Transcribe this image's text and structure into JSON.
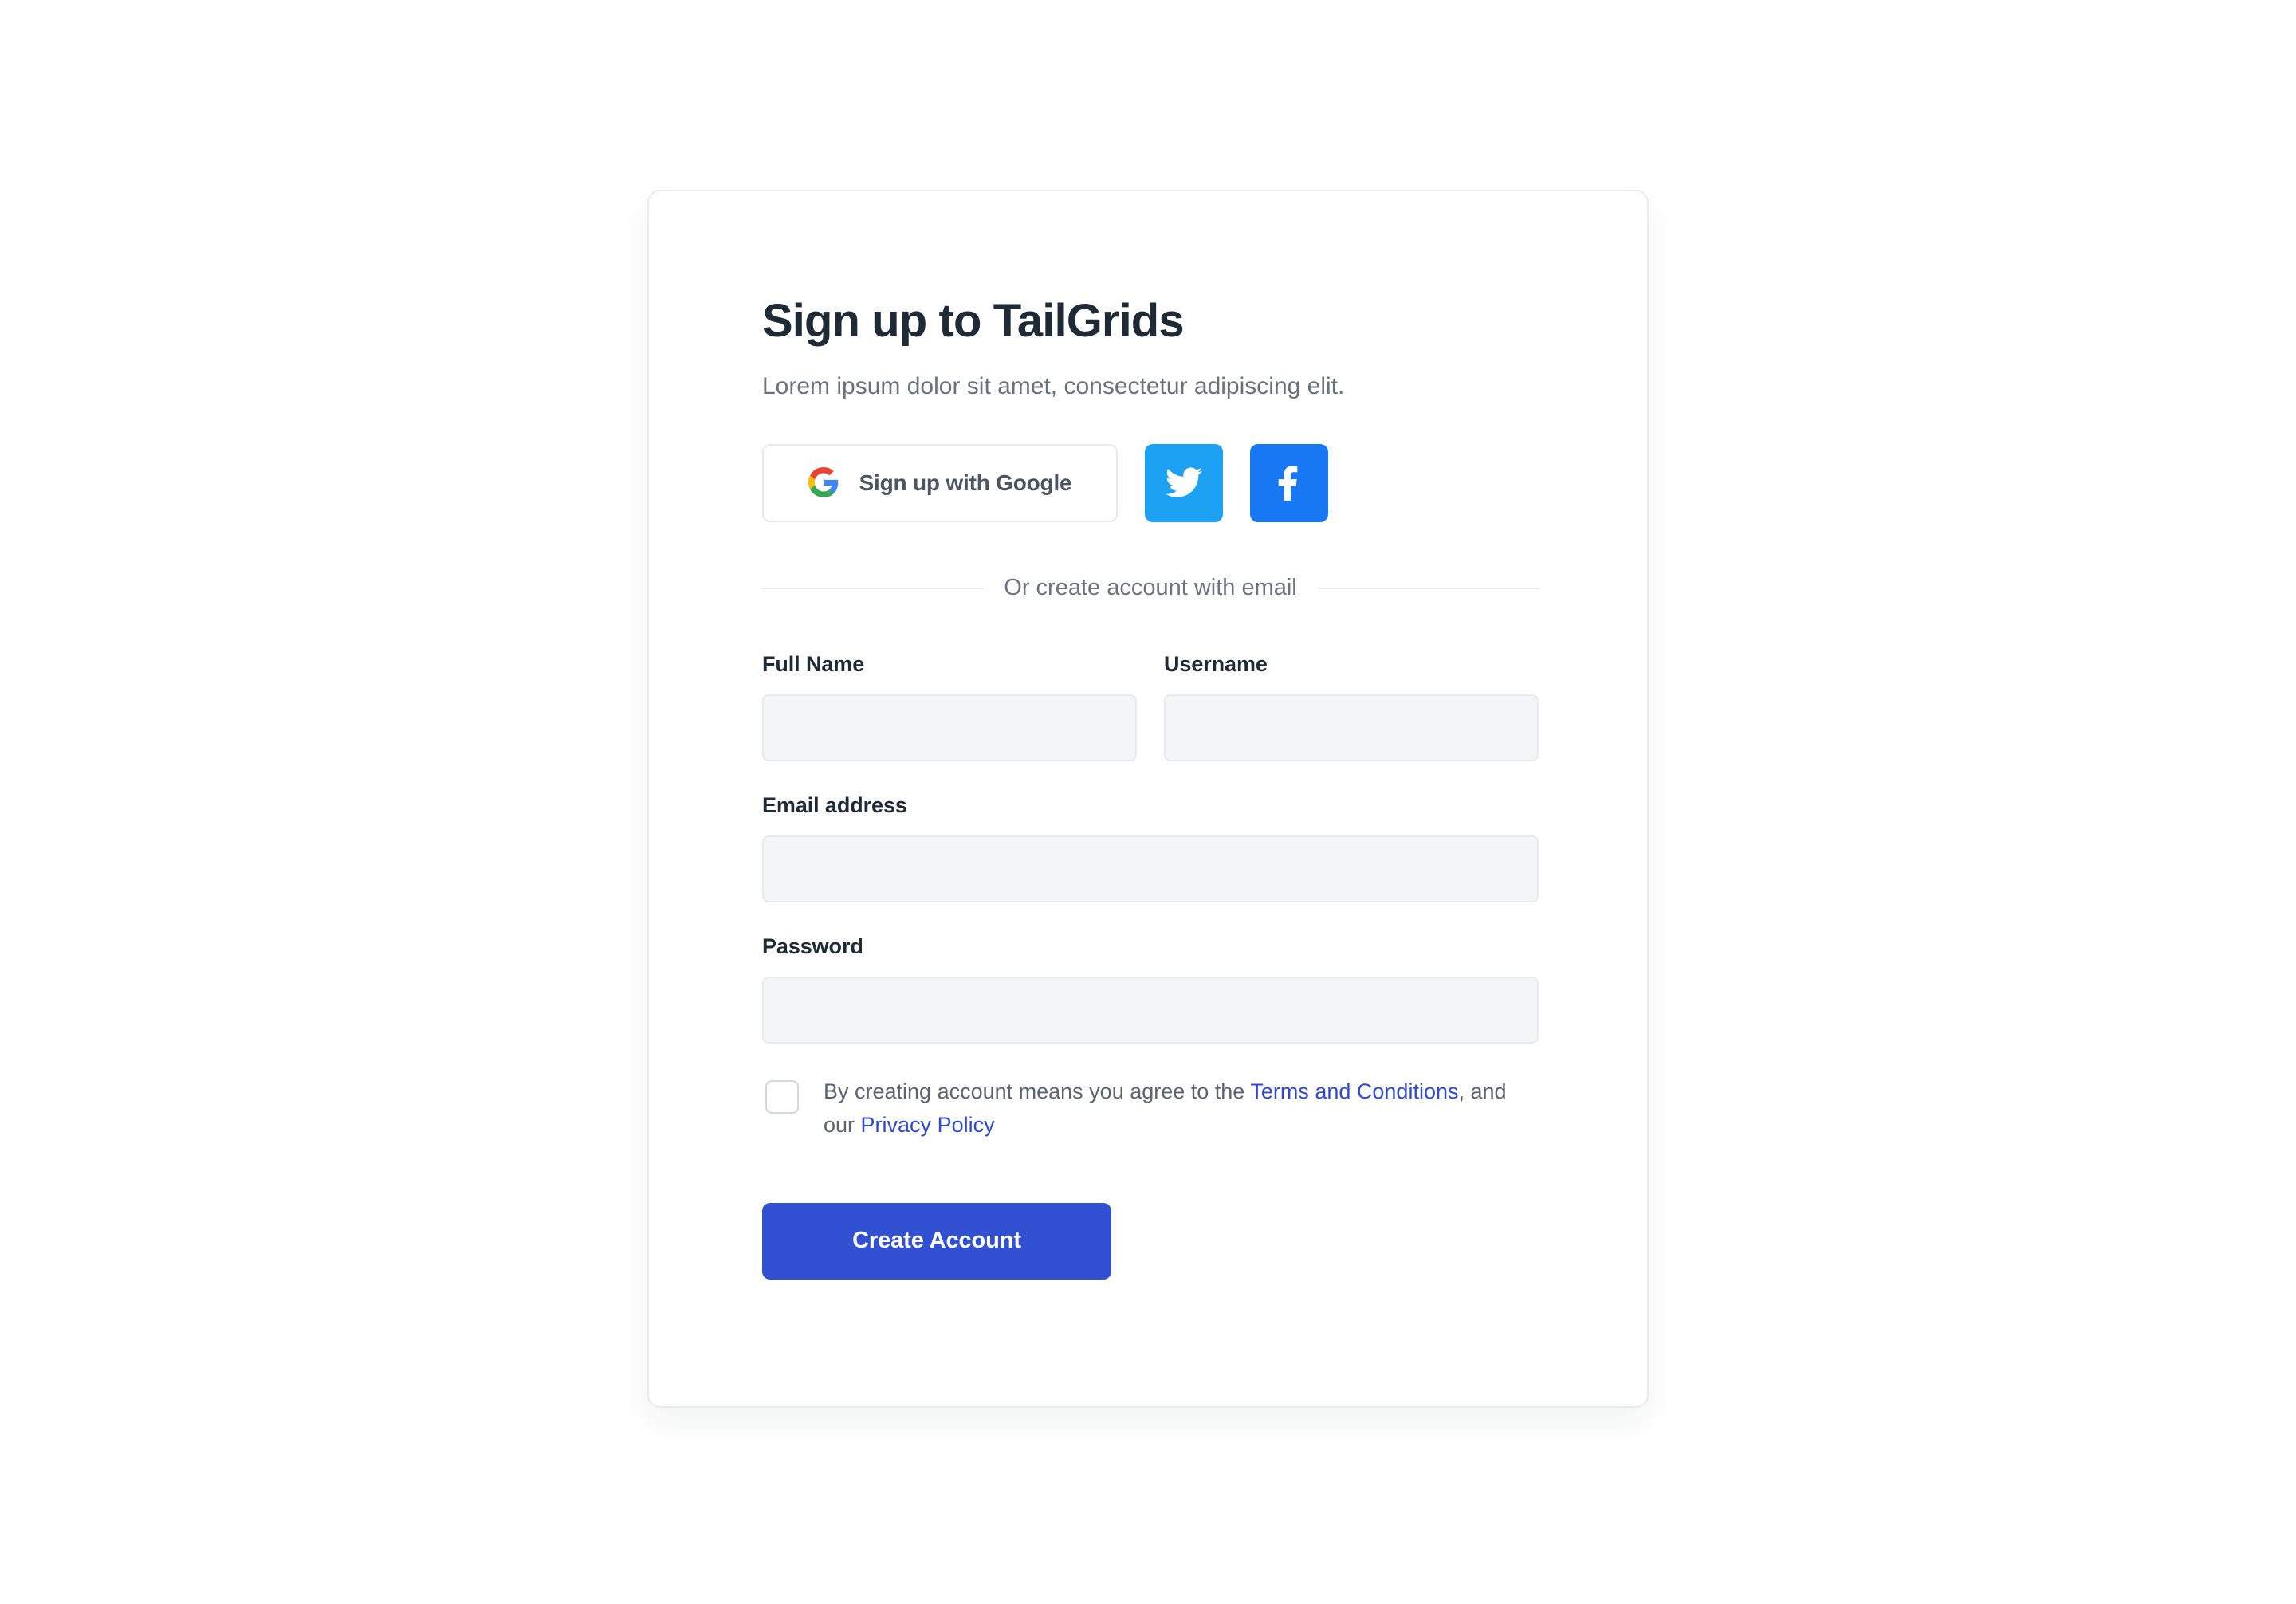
{
  "card": {
    "title": "Sign up to TailGrids",
    "subtitle": "Lorem ipsum dolor sit amet, consectetur adipiscing elit."
  },
  "social": {
    "google_label": "Sign up with Google",
    "google_icon": "google-icon",
    "twitter_icon": "twitter-icon",
    "facebook_icon": "facebook-icon",
    "twitter_color": "#1DA1F2",
    "facebook_color": "#1877F2"
  },
  "divider": {
    "text": "Or create account with email"
  },
  "form": {
    "full_name": {
      "label": "Full Name",
      "value": "",
      "placeholder": ""
    },
    "username": {
      "label": "Username",
      "value": "",
      "placeholder": ""
    },
    "email": {
      "label": "Email address",
      "value": "",
      "placeholder": ""
    },
    "password": {
      "label": "Password",
      "value": "",
      "placeholder": ""
    }
  },
  "terms": {
    "checked": false,
    "text_before": "By creating account means you agree to the",
    "terms_link": "Terms and Conditions",
    "text_middle": ", and our",
    "privacy_link": "Privacy Policy",
    "link_color": "#2F49D1"
  },
  "submit": {
    "label": "Create Account",
    "color": "#3250D2"
  }
}
